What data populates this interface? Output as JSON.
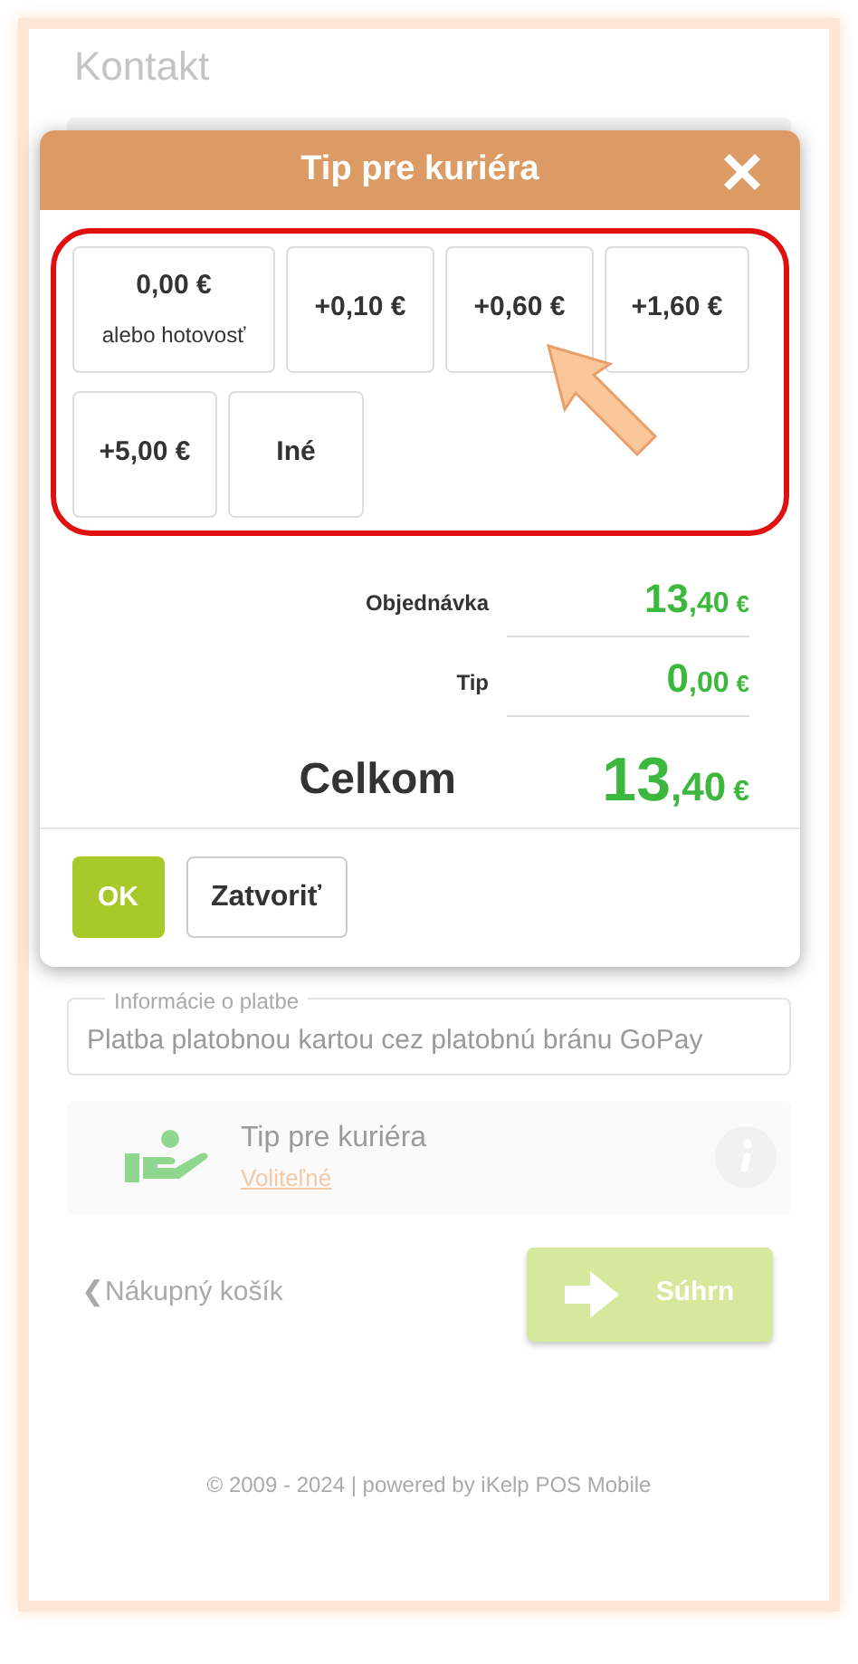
{
  "page": {
    "heading": "Kontakt"
  },
  "dialog": {
    "title": "Tip pre kuriéra",
    "tip_options": [
      {
        "amount": "0,00 €",
        "note": "alebo hotovosť",
        "selected": false
      },
      {
        "amount": "+0,10 €",
        "selected": false
      },
      {
        "amount": "+0,60 €",
        "selected": false
      },
      {
        "amount": "+1,60 €",
        "selected": false
      },
      {
        "amount": "+5,00 €",
        "selected": false
      },
      {
        "amount": "Iné",
        "selected": false
      }
    ],
    "totals": [
      {
        "kind": "small",
        "label": "Objednávka",
        "whole": "13",
        "fraction": ",40",
        "currency": "€"
      },
      {
        "kind": "small",
        "label": "Tip",
        "whole": "0",
        "fraction": ",00",
        "currency": "€"
      },
      {
        "kind": "large",
        "label": "Celkom",
        "whole": "13",
        "fraction": ",40",
        "currency": "€"
      }
    ],
    "buttons": [
      "OK",
      "Zatvoriť"
    ]
  },
  "payment": {
    "legend": "Informácie o platbe",
    "value": "Platba platobnou kartou cez platobnú bránu GoPay"
  },
  "tip_card": {
    "title": "Tip pre kuriéra",
    "link": "Voliteľné"
  },
  "nav": {
    "back": "Nákupný košík",
    "back_icon": "❮",
    "next": "Súhrn"
  },
  "footer": "© 2009 - 2024 | powered by iKelp POS Mobile"
}
